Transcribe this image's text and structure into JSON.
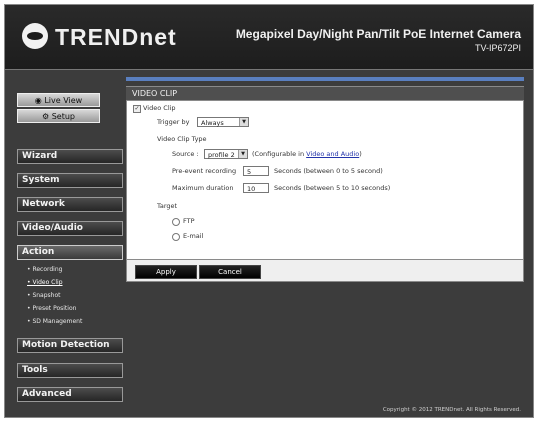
{
  "header": {
    "brand": "TRENDnet",
    "product_title": "Megapixel Day/Night Pan/Tilt PoE Internet Camera",
    "model": "TV-IP672PI"
  },
  "sidebar": {
    "live_view": "Live View",
    "setup": "Setup",
    "menus": {
      "wizard": "Wizard",
      "system": "System",
      "network": "Network",
      "video_audio": "Video/Audio",
      "action": "Action",
      "motion_detection": "Motion Detection",
      "tools": "Tools",
      "advanced": "Advanced"
    },
    "action_items": [
      "• Recording",
      "• Video Clip",
      "• Snapshot",
      "• Preset Position",
      "• SD Management"
    ]
  },
  "content": {
    "title": "VIDEO CLIP",
    "video_clip_label": "Video Clip",
    "trigger_by_label": "Trigger by",
    "trigger_by_value": "Always",
    "type_section": "Video Clip Type",
    "source_label": "Source :",
    "source_value": "profile 2",
    "source_note_prefix": "(Configurable in ",
    "source_note_link": "Video and Audio",
    "source_note_suffix": ")",
    "pre_event_label": "Pre-event recording",
    "pre_event_value": "5",
    "pre_event_note": "Seconds  (between 0 to 5 second)",
    "max_duration_label": "Maximum duration",
    "max_duration_value": "10",
    "max_duration_note": "Seconds  (between 5 to 10 seconds)",
    "target_label": "Target",
    "ftp_label": "FTP",
    "email_label": "E-mail",
    "apply": "Apply",
    "cancel": "Cancel"
  },
  "footer": {
    "copyright": "Copyright © 2012 TRENDnet. All Rights Reserved."
  }
}
